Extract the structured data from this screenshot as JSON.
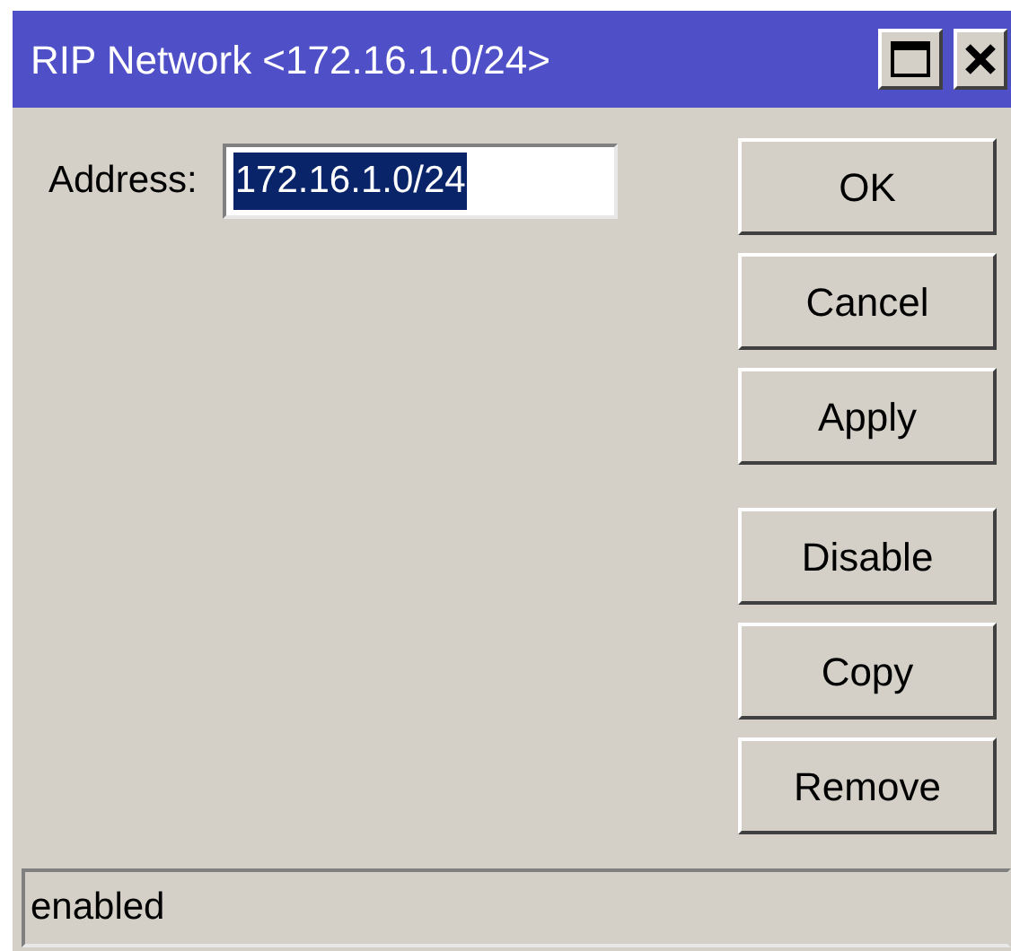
{
  "window": {
    "title": "RIP Network <172.16.1.0/24>"
  },
  "fields": [
    {
      "label": "Address:",
      "value": "172.16.1.0/24",
      "text_selected": true
    }
  ],
  "button_groups": [
    [
      "OK",
      "Cancel",
      "Apply"
    ],
    [
      "Disable",
      "Copy",
      "Remove"
    ]
  ],
  "status_bar": "enabled"
}
